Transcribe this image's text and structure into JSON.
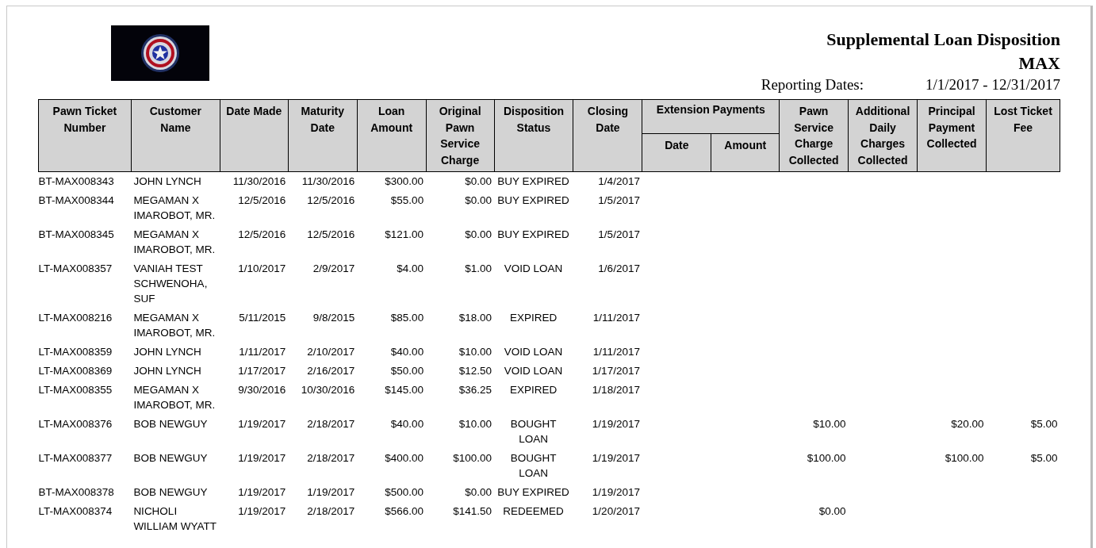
{
  "report": {
    "title": "Supplemental Loan Disposition",
    "store": "MAX",
    "reporting_label": "Reporting Dates:",
    "reporting_range": "1/1/2017 - 12/31/2017"
  },
  "table": {
    "column_group": {
      "label": "Extension Payments"
    },
    "columns": [
      {
        "label": "Pawn Ticket Number"
      },
      {
        "label": "Customer Name"
      },
      {
        "label": "Date Made"
      },
      {
        "label": "Maturity Date"
      },
      {
        "label": "Loan Amount"
      },
      {
        "label": "Original Pawn Service Charge"
      },
      {
        "label": "Disposition Status"
      },
      {
        "label": "Closing Date"
      },
      {
        "label": "Date",
        "kind": "grouped"
      },
      {
        "label": "Amount",
        "kind": "grouped"
      },
      {
        "label": "Pawn Service Charge Collected"
      },
      {
        "label": "Additional Daily Charges Collected"
      },
      {
        "label": "Principal Payment Collected"
      },
      {
        "label": "Lost Ticket Fee"
      }
    ],
    "rows": [
      [
        "BT-MAX008343",
        "JOHN LYNCH",
        "11/30/2016",
        "11/30/2016",
        "$300.00",
        "$0.00",
        "BUY EXPIRED",
        "1/4/2017",
        null,
        null,
        null,
        null,
        null,
        null
      ],
      [
        "BT-MAX008344",
        "MEGAMAN X IMAROBOT, MR.",
        "12/5/2016",
        "12/5/2016",
        "$55.00",
        "$0.00",
        "BUY EXPIRED",
        "1/5/2017",
        null,
        null,
        null,
        null,
        null,
        null
      ],
      [
        "BT-MAX008345",
        "MEGAMAN X IMAROBOT, MR.",
        "12/5/2016",
        "12/5/2016",
        "$121.00",
        "$0.00",
        "BUY EXPIRED",
        "1/5/2017",
        null,
        null,
        null,
        null,
        null,
        null
      ],
      [
        "LT-MAX008357",
        "VANIAH TEST SCHWENOHA, SUF",
        "1/10/2017",
        "2/9/2017",
        "$4.00",
        "$1.00",
        "VOID LOAN",
        "1/6/2017",
        null,
        null,
        null,
        null,
        null,
        null
      ],
      [
        "LT-MAX008216",
        "MEGAMAN X IMAROBOT, MR.",
        "5/11/2015",
        "9/8/2015",
        "$85.00",
        "$18.00",
        "EXPIRED",
        "1/11/2017",
        null,
        null,
        null,
        null,
        null,
        null
      ],
      [
        "LT-MAX008359",
        "JOHN LYNCH",
        "1/11/2017",
        "2/10/2017",
        "$40.00",
        "$10.00",
        "VOID LOAN",
        "1/11/2017",
        null,
        null,
        null,
        null,
        null,
        null
      ],
      [
        "LT-MAX008369",
        "JOHN LYNCH",
        "1/17/2017",
        "2/16/2017",
        "$50.00",
        "$12.50",
        "VOID LOAN",
        "1/17/2017",
        null,
        null,
        null,
        null,
        null,
        null
      ],
      [
        "LT-MAX008355",
        "MEGAMAN X IMAROBOT, MR.",
        "9/30/2016",
        "10/30/2016",
        "$145.00",
        "$36.25",
        "EXPIRED",
        "1/18/2017",
        null,
        null,
        null,
        null,
        null,
        null
      ],
      [
        "LT-MAX008376",
        "BOB NEWGUY",
        "1/19/2017",
        "2/18/2017",
        "$40.00",
        "$10.00",
        "BOUGHT LOAN",
        "1/19/2017",
        null,
        null,
        "$10.00",
        null,
        "$20.00",
        "$5.00"
      ],
      [
        "LT-MAX008377",
        "BOB NEWGUY",
        "1/19/2017",
        "2/18/2017",
        "$400.00",
        "$100.00",
        "BOUGHT LOAN",
        "1/19/2017",
        null,
        null,
        "$100.00",
        null,
        "$100.00",
        "$5.00"
      ],
      [
        "BT-MAX008378",
        "BOB NEWGUY",
        "1/19/2017",
        "1/19/2017",
        "$500.00",
        "$0.00",
        "BUY EXPIRED",
        "1/19/2017",
        null,
        null,
        null,
        null,
        null,
        null
      ],
      [
        "LT-MAX008374",
        "NICHOLI WILLIAM WYATT",
        "1/19/2017",
        "2/18/2017",
        "$566.00",
        "$141.50",
        "REDEEMED",
        "1/20/2017",
        null,
        null,
        "$0.00",
        null,
        null,
        null
      ]
    ]
  }
}
